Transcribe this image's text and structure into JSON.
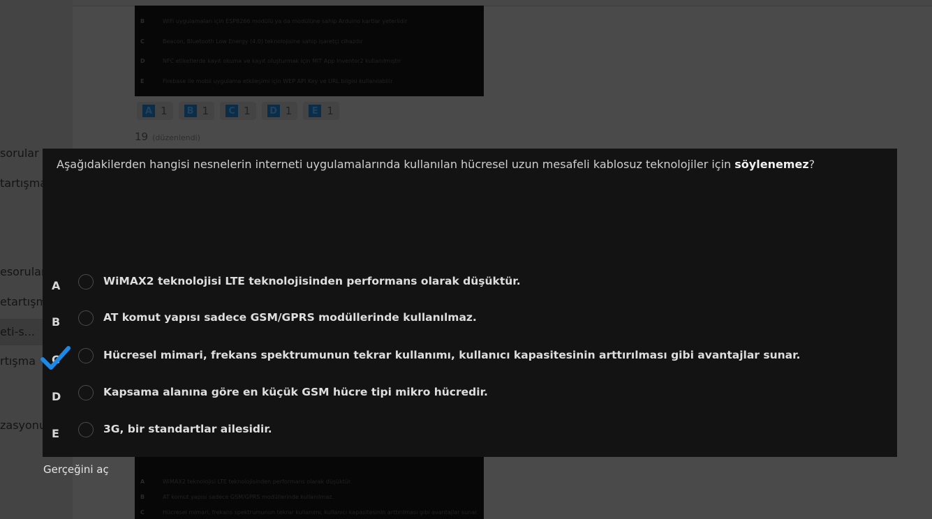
{
  "sidebar": {
    "items": [
      {
        "label": "sorular"
      },
      {
        "label": "tartışma"
      },
      {
        "label": "esorular"
      },
      {
        "label": "etartışm"
      },
      {
        "label": "eti-s..."
      },
      {
        "label": "rtışma"
      },
      {
        "label": "zasyonu"
      }
    ]
  },
  "prev_question": {
    "options": [
      {
        "letter": "B",
        "text": "WiFi uygulamaları için ESP8266 modülü ya da modülüne sahip Arduino kartlar yeterlidir"
      },
      {
        "letter": "C",
        "text": "Beacon, Bluetooth Low Energy (4.0) teknolojisine sahip işaretçi cihazdır"
      },
      {
        "letter": "D",
        "text": "NFC etiketlerde kayıt okuma ve kayıt oluşturmak için MIT App Inventor2 kullanılmıştır"
      },
      {
        "letter": "E",
        "text": "Firebase ile mobil uygulama etkileşimi için WEP API Key ve URL bilgisi kullanılabilir"
      }
    ],
    "votes": [
      {
        "letter": "A",
        "count": "1"
      },
      {
        "letter": "B",
        "count": "1"
      },
      {
        "letter": "C",
        "count": "1"
      },
      {
        "letter": "D",
        "count": "1"
      },
      {
        "letter": "E",
        "count": "1"
      }
    ]
  },
  "next_card": {
    "number": "19",
    "edited_label": "(düzenlendi)",
    "options": [
      {
        "letter": "A",
        "text": "WiMAX2 teknolojisi LTE teknolojisinden performans olarak düşüktür."
      },
      {
        "letter": "B",
        "text": "AT komut yapısı sadece GSM/GPRS modüllerinde kullanılmaz."
      },
      {
        "letter": "C",
        "text": "Hücresel mimari, frekans spektrumunun tekrar kullanımı, kullanıcı kapasitesinin arttırılması gibi avantajlar sunar."
      }
    ]
  },
  "modal": {
    "question_main": "Aşağıdakilerden hangisi nesnelerin interneti uygulamalarında kullanılan hücresel uzun mesafeli kablosuz teknolojiler için ",
    "question_bold": "söylenemez",
    "question_end": "?",
    "options": [
      {
        "letter": "A",
        "text": "WiMAX2 teknolojisi LTE teknolojisinden performans olarak düşüktür."
      },
      {
        "letter": "B",
        "text": "AT komut yapısı sadece GSM/GPRS modüllerinde kullanılmaz."
      },
      {
        "letter": "C",
        "text": "Hücresel mimari, frekans spektrumunun tekrar kullanımı, kullanıcı kapasitesinin arttırılması gibi avantajlar sunar."
      },
      {
        "letter": "D",
        "text": "Kapsama alanına göre en küçük GSM hücre tipi mikro hücredir."
      },
      {
        "letter": "E",
        "text": "3G, bir standartlar ailesidir."
      }
    ],
    "checked_letter": "C",
    "check_color": "#1e88e5"
  },
  "reveal_label": "Gerçeğini aç"
}
